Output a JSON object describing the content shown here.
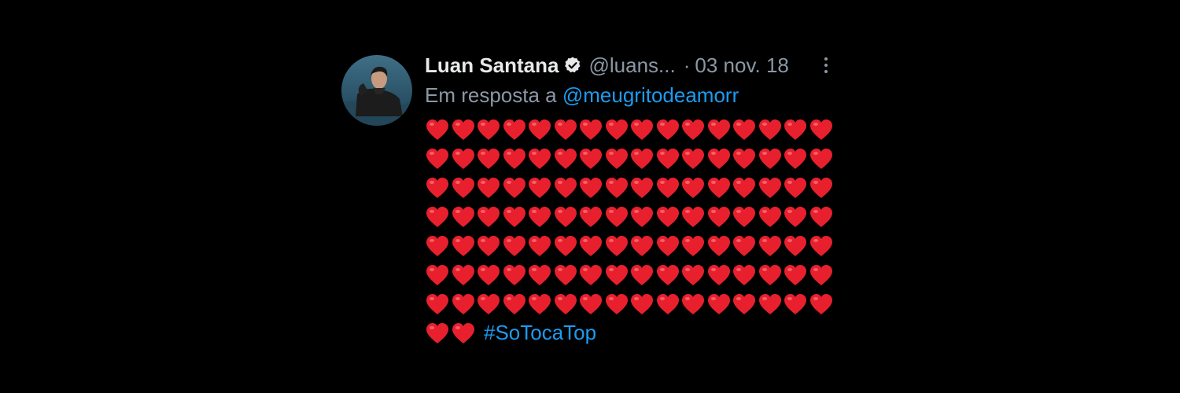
{
  "tweet": {
    "author_name": "Luan Santana",
    "handle": "@luans...",
    "separator": "·",
    "date": "03 nov. 18",
    "reply_prefix": "Em resposta a",
    "reply_mention": "@meugritodeamorr",
    "hashtag": "#SoTocaTop",
    "heart_rows": [
      16,
      16,
      16,
      16,
      16,
      16,
      16,
      2
    ],
    "colors": {
      "background": "#000000",
      "name": "#e7e9ea",
      "secondary": "#8b98a5",
      "link": "#1d9bf0",
      "heart": "#e8202e"
    },
    "icons": {
      "verified": "verified-badge-icon",
      "more": "more-options-icon",
      "heart": "red-heart-emoji"
    }
  }
}
